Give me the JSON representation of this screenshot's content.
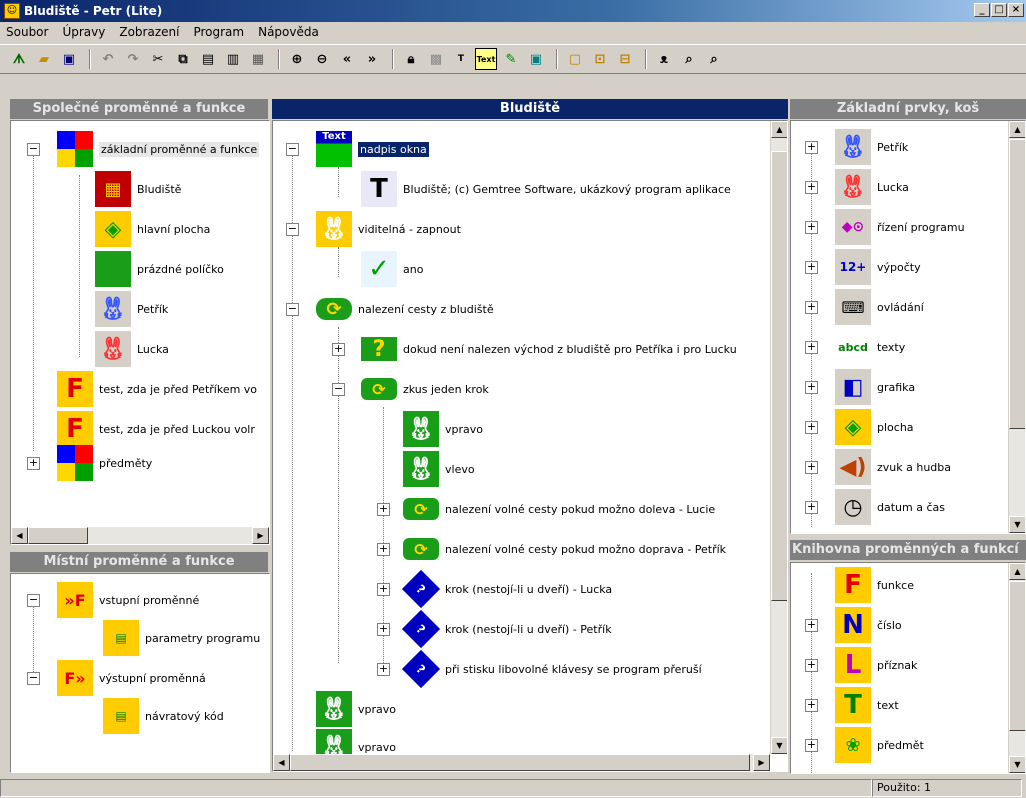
{
  "window": {
    "title": "Bludiště - Petr (Lite)",
    "buttons": [
      "_",
      "□",
      "×"
    ]
  },
  "menu": [
    "Soubor",
    "Úpravy",
    "Zobrazení",
    "Program",
    "Nápověda"
  ],
  "toolbar": {
    "text_label": "Text"
  },
  "left_top": {
    "title": "Společné proměnné a funkce",
    "items": [
      "základní proměnné a funkce",
      "Bludiště",
      "hlavní plocha",
      "prázdné políčko",
      "Petřík",
      "Lucka",
      "test, zda je před Petříkem vo",
      "test, zda je před Luckou volr",
      "předměty"
    ]
  },
  "left_bottom": {
    "title": "Místní proměnné a funkce",
    "items": [
      "vstupní proměnné",
      "parametry programu",
      "výstupní proměnná",
      "návratový kód"
    ]
  },
  "center": {
    "title": "Bludiště",
    "items": [
      "nadpis okna",
      "Bludiště;   (c) Gemtree Software, ukázkový program aplikace",
      "viditelná - zapnout",
      "ano",
      "nalezení cesty z bludiště",
      "dokud není nalezen východ z bludiště pro Petříka i pro Lucku",
      "zkus jeden krok",
      "vpravo",
      "vlevo",
      "nalezení volné cesty pokud možno doleva - Lucie",
      "nalezení volné cesty pokud možno doprava - Petřík",
      "krok (nestojí-li u dveří) - Lucka",
      "krok (nestojí-li u dveří) - Petřík",
      "při stisku libovolné klávesy se program přeruší",
      "vpravo",
      "vpravo"
    ],
    "text_icon_label": "Text"
  },
  "right_top": {
    "title": "Základní prvky, koš",
    "items": [
      "Petřík",
      "Lucka",
      "řízení programu",
      "výpočty",
      "ovládání",
      "texty",
      "grafika",
      "plocha",
      "zvuk a hudba",
      "datum a čas"
    ]
  },
  "right_bottom": {
    "title": "Knihovna proměnných a funkcí",
    "items": [
      "funkce",
      "číslo",
      "příznak",
      "text",
      "předmět"
    ]
  },
  "status": {
    "used": "Použito: 1"
  }
}
